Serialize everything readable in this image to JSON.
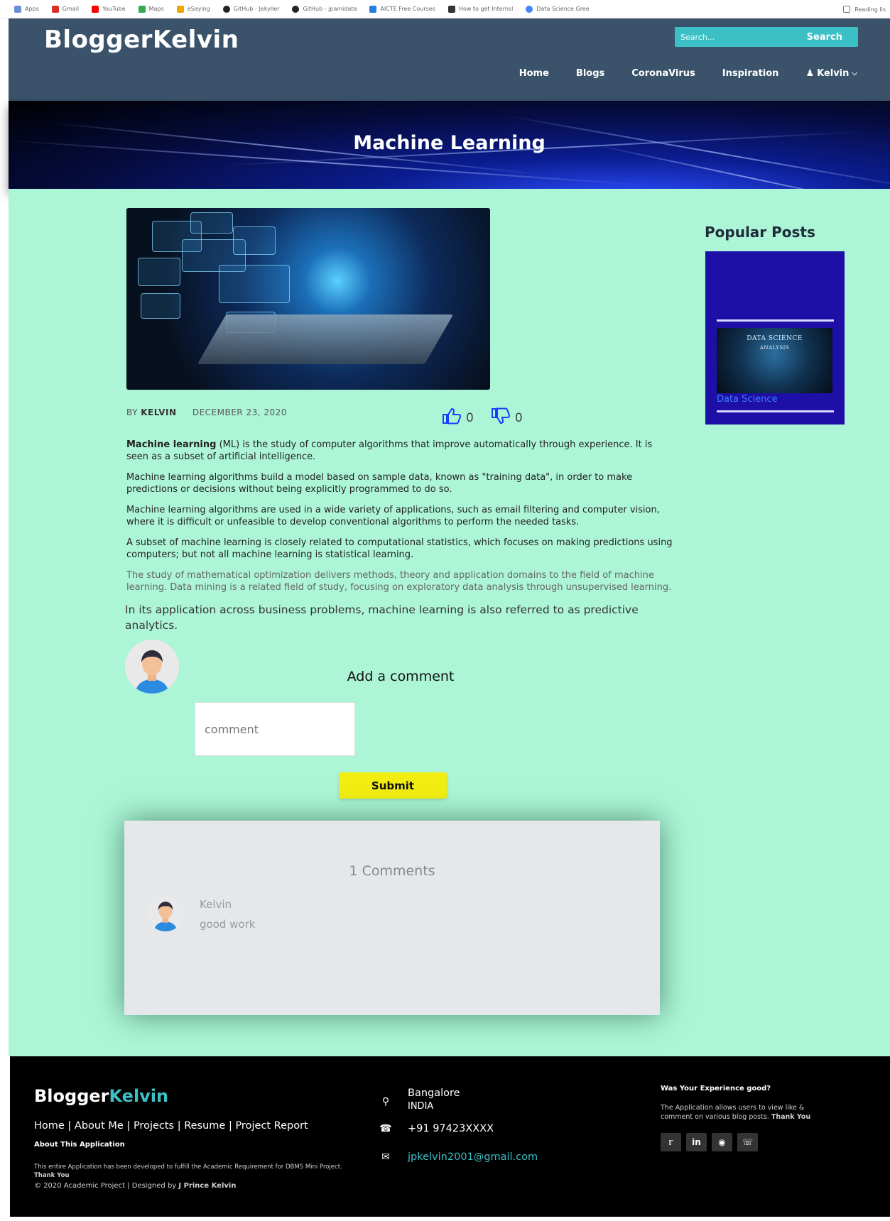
{
  "bookmarks": {
    "items": [
      "Apps",
      "Gmail",
      "YouTube",
      "Maps",
      "eSaying",
      "GitHub - Jekyller",
      "GitHub - jpamidata",
      "AICTE Free Courses",
      "How to get Internsl",
      "Data Science Gree"
    ],
    "reading_list": "Reading lis"
  },
  "header": {
    "logo": "BloggerKelvin",
    "search_placeholder": "Search...",
    "search_button": "Search",
    "nav": [
      "Home",
      "Blogs",
      "CoronaVirus",
      "Inspiration"
    ],
    "user_menu": "Kelvin"
  },
  "banner": {
    "title": "Machine Learning"
  },
  "post": {
    "by_label": "BY",
    "author": "KELVIN",
    "date": "DECEMBER 23, 2020",
    "likes": "0",
    "dislikes": "0",
    "paragraphs": {
      "p1_bold": "Machine learning",
      "p1_rest": " (ML) is the study of computer algorithms that improve automatically through experience. It is seen as a subset of artificial intelligence.",
      "p2": "Machine learning algorithms build a model based on sample data, known as \"training data\", in order to make predictions or decisions without being explicitly programmed to do so.",
      "p3": "Machine learning algorithms are used in a wide variety of applications, such as email filtering and computer vision, where it is difficult or unfeasible to develop conventional algorithms to perform the needed tasks.",
      "p4": "A subset of machine learning is closely related to computational statistics, which focuses on making predictions using computers; but not all machine learning is statistical learning.",
      "p5": "The study of mathematical optimization delivers methods, theory and application domains to the field of machine learning. Data mining is a related field of study, focusing on exploratory data analysis through unsupervised learning.",
      "p6": "In its application across business problems, machine learning is also referred to as predictive analytics."
    }
  },
  "comment_form": {
    "heading": "Add a comment",
    "placeholder": "comment",
    "submit": "Submit"
  },
  "comments": {
    "title": "1 Comments",
    "items": [
      {
        "name": "Kelvin",
        "text": "good work"
      }
    ]
  },
  "sidebar": {
    "title": "Popular Posts",
    "card_image_text": "DATA SCIENCE",
    "card_image_sub": "ANALYSIS",
    "card_link": "Data Science"
  },
  "footer": {
    "logo_main": "Blogger",
    "logo_accent": "Kelvin",
    "links": "Home | About Me | Projects | Resume | Project Report",
    "about_title": "About This Application",
    "about_text": "This entire Application has been developed to fulfill the Academic Requirement for DBMS Mini Project.",
    "about_thanks": "Thank You",
    "copyright": "© 2020 Academic Project | Designed by",
    "designer": "J Prince Kelvin",
    "city": "Bangalore",
    "country": "INDIA",
    "phone": "+91 97423XXXX",
    "email": "jpkelvin2001@gmail.com",
    "exp_title": "Was Your Experience good?",
    "exp_text": "The Application allows users to view like & comment on various blog posts.",
    "exp_thanks": "Thank You",
    "social": [
      "twitter",
      "linkedin",
      "github",
      "whatsapp"
    ]
  }
}
